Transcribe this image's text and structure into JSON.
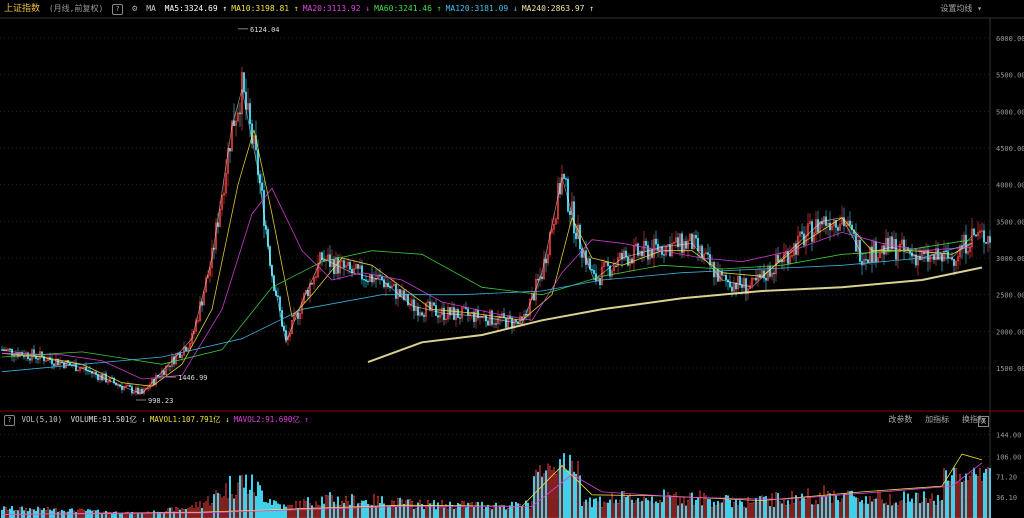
{
  "header": {
    "title": "上证指数",
    "subtitle": "(月线,前复权)",
    "help_label": "?",
    "ma_label": "MA",
    "ma_items": [
      {
        "text": "MA5:3324.69",
        "color": "#ffffff"
      },
      {
        "text": "MA10:3198.81",
        "color": "#f0e040"
      },
      {
        "text": "MA20:3113.92",
        "color": "#e040e0"
      },
      {
        "text": "MA60:3241.46",
        "color": "#40e040"
      },
      {
        "text": "MA120:3181.09",
        "color": "#40c0f0"
      },
      {
        "text": "MA240:2863.97",
        "color": "#f0e8a0"
      }
    ],
    "ma_arrows": [
      "↑",
      "↑",
      "↓",
      "↑",
      "↓",
      "↑"
    ],
    "settings_label": "设置均线 ▾"
  },
  "volume_header": {
    "label": "VOL(5,10)",
    "items": [
      {
        "text": "VOLUME:91.501亿",
        "color": "#dddddd"
      },
      {
        "text": "MAVOL1:107.791亿",
        "color": "#f0e040"
      },
      {
        "text": "MAVOL2:91.690亿",
        "color": "#e040e0"
      }
    ],
    "arrows": [
      "↓",
      "↓",
      "↑"
    ],
    "tools": [
      "改参数",
      "加指标",
      "换指标"
    ],
    "close": "X"
  },
  "colors": {
    "up": "#ff4040",
    "down": "#40d8f0",
    "ma5": "#ffffff",
    "ma10": "#f0e040",
    "ma20": "#e040e0",
    "ma60": "#40e040",
    "ma120": "#40c0f0",
    "ma240": "#f0e8a0"
  },
  "chart_data": {
    "type": "line",
    "price_axis": {
      "ticks": [
        "6000.00",
        "5500.00",
        "5000.00",
        "4500.00",
        "4000.00",
        "3500.00",
        "3000.00",
        "2500.00",
        "2000.00",
        "1500.00"
      ],
      "ylim": [
        1500,
        6000
      ]
    },
    "volume_axis": {
      "ticks": [
        "144.00",
        "106.00",
        "71.20",
        "36.10"
      ],
      "unit": "亿"
    },
    "annotations": [
      {
        "text": "6124.04",
        "x_index": 118,
        "y": 6124.04
      },
      {
        "text": "998.23",
        "x_index": 67,
        "y": 998.23
      },
      {
        "text": "1446.99",
        "x_index": 82,
        "y": 1446.99
      }
    ],
    "series_ma": [
      {
        "name": "MA5",
        "points": [
          [
            0,
            1750
          ],
          [
            20,
            1650
          ],
          [
            40,
            1500
          ],
          [
            60,
            1250
          ],
          [
            70,
            1150
          ],
          [
            80,
            1450
          ],
          [
            95,
            1900
          ],
          [
            105,
            3000
          ],
          [
            115,
            4800
          ],
          [
            120,
            5300
          ],
          [
            128,
            4200
          ],
          [
            135,
            2800
          ],
          [
            142,
            1850
          ],
          [
            150,
            2400
          ],
          [
            160,
            3000
          ],
          [
            175,
            2800
          ],
          [
            190,
            2700
          ],
          [
            205,
            2350
          ],
          [
            220,
            2250
          ],
          [
            240,
            2200
          ],
          [
            260,
            2100
          ],
          [
            270,
            2800
          ],
          [
            280,
            4100
          ],
          [
            288,
            3300
          ],
          [
            296,
            2700
          ],
          [
            310,
            3000
          ],
          [
            330,
            3150
          ],
          [
            345,
            3200
          ],
          [
            360,
            2700
          ],
          [
            375,
            2600
          ],
          [
            390,
            3000
          ],
          [
            410,
            3500
          ],
          [
            420,
            3550
          ],
          [
            430,
            3050
          ],
          [
            445,
            3150
          ],
          [
            460,
            3000
          ],
          [
            475,
            3000
          ],
          [
            485,
            3300
          ]
        ]
      },
      {
        "name": "MA10",
        "points": [
          [
            0,
            1700
          ],
          [
            20,
            1650
          ],
          [
            40,
            1550
          ],
          [
            60,
            1300
          ],
          [
            75,
            1250
          ],
          [
            90,
            1550
          ],
          [
            105,
            2300
          ],
          [
            118,
            4000
          ],
          [
            126,
            4750
          ],
          [
            135,
            3600
          ],
          [
            145,
            2200
          ],
          [
            155,
            2500
          ],
          [
            170,
            3000
          ],
          [
            185,
            2900
          ],
          [
            200,
            2600
          ],
          [
            215,
            2300
          ],
          [
            235,
            2250
          ],
          [
            260,
            2150
          ],
          [
            275,
            2500
          ],
          [
            285,
            3550
          ],
          [
            295,
            3000
          ],
          [
            310,
            2900
          ],
          [
            330,
            3100
          ],
          [
            345,
            3100
          ],
          [
            360,
            2800
          ],
          [
            380,
            2750
          ],
          [
            400,
            3200
          ],
          [
            420,
            3550
          ],
          [
            435,
            3100
          ],
          [
            455,
            3100
          ],
          [
            475,
            3050
          ],
          [
            485,
            3200
          ]
        ]
      },
      {
        "name": "MA20",
        "points": [
          [
            0,
            1700
          ],
          [
            30,
            1680
          ],
          [
            50,
            1600
          ],
          [
            70,
            1350
          ],
          [
            90,
            1400
          ],
          [
            110,
            2300
          ],
          [
            125,
            3600
          ],
          [
            135,
            3950
          ],
          [
            150,
            3100
          ],
          [
            165,
            2700
          ],
          [
            180,
            2800
          ],
          [
            200,
            2700
          ],
          [
            220,
            2400
          ],
          [
            245,
            2250
          ],
          [
            265,
            2150
          ],
          [
            280,
            2800
          ],
          [
            295,
            3250
          ],
          [
            310,
            3200
          ],
          [
            330,
            3100
          ],
          [
            350,
            3000
          ],
          [
            370,
            2950
          ],
          [
            395,
            3100
          ],
          [
            420,
            3350
          ],
          [
            440,
            3200
          ],
          [
            460,
            3100
          ],
          [
            485,
            3150
          ]
        ]
      },
      {
        "name": "MA60",
        "points": [
          [
            0,
            1650
          ],
          [
            40,
            1720
          ],
          [
            80,
            1550
          ],
          [
            110,
            1750
          ],
          [
            135,
            2600
          ],
          [
            160,
            2950
          ],
          [
            185,
            3100
          ],
          [
            210,
            3050
          ],
          [
            240,
            2600
          ],
          [
            270,
            2500
          ],
          [
            300,
            2750
          ],
          [
            330,
            2900
          ],
          [
            360,
            2850
          ],
          [
            390,
            2900
          ],
          [
            420,
            3050
          ],
          [
            450,
            3100
          ],
          [
            485,
            3250
          ]
        ]
      },
      {
        "name": "MA120",
        "points": [
          [
            0,
            1450
          ],
          [
            40,
            1550
          ],
          [
            80,
            1650
          ],
          [
            120,
            1900
          ],
          [
            150,
            2300
          ],
          [
            190,
            2500
          ],
          [
            230,
            2500
          ],
          [
            270,
            2550
          ],
          [
            300,
            2700
          ],
          [
            340,
            2800
          ],
          [
            380,
            2850
          ],
          [
            420,
            2900
          ],
          [
            460,
            3000
          ],
          [
            485,
            3200
          ]
        ]
      },
      {
        "name": "MA240",
        "points": [
          [
            183,
            1580
          ],
          [
            210,
            1850
          ],
          [
            240,
            1950
          ],
          [
            270,
            2150
          ],
          [
            300,
            2300
          ],
          [
            340,
            2450
          ],
          [
            380,
            2550
          ],
          [
            420,
            2600
          ],
          [
            460,
            2700
          ],
          [
            490,
            2870
          ]
        ]
      }
    ]
  }
}
